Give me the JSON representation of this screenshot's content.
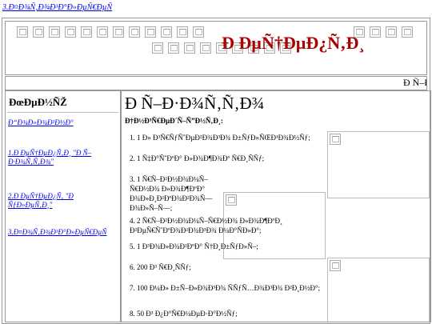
{
  "top_link": "3.Ð¤Ð¾Ñ‚Ð¾Ð³Ð°Ð»ÐµÑ€ÐµÑ",
  "site_title": "Ð ÐµÑ†ÐµÐ¿Ñ‚Ð¸",
  "strip_text": "Ð Ñ–Ð",
  "sidebar": {
    "heading": "ÐœÐµÐ½ÑŽ",
    "items": [
      {
        "label": "Ð“Ð¾Ð»Ð¾Ð²Ð½Ð°"
      },
      {
        "label": "1.Ð ÐµÑ†ÐµÐ¿Ñ‚Ð¸ \"Ð Ñ–Ð·Ð¾Ñ‚Ñ‚Ð¾\""
      },
      {
        "label": "2.Ð ÐµÑ†ÐµÐ¿Ñ‚ \"Ð ÑƒÐ»ÐµÑ‚Ð¸\""
      },
      {
        "label": "3.Ð¤Ð¾Ñ‚Ð¾Ð³Ð°Ð»ÐµÑ€ÐµÑ"
      }
    ]
  },
  "main": {
    "title": "Ð Ñ–Ð·Ð¾Ñ‚Ñ‚Ð¾",
    "subtitle": "Ð†Ð½Ð³Ñ€ÐµÐ´Ñ–Ñ”Ð½Ñ‚Ð¸:",
    "ingredients": [
      "1. 1 Ð» Ð³Ñ€ÑƒÑˆÐµÐ²Ð¾Ð³Ð¾ Ð±ÑƒÐ»ÑŒÐ¹Ð¾Ð½Ñƒ;",
      "2. 1 Ñ‡Ð°ÑˆÐºÐ° Ð»Ð¾Ð¶Ð¾Ðº Ñ€Ð¸ÑÑƒ;",
      "3. 1     Ñ€Ñ–Ð²Ð½Ð¾Ð¼Ñ–Ñ€Ð½Ð¾ Ð»Ð¾Ð¶ÐºÐ° Ð¾Ð»Ð¸Ð²ÐºÐ¾Ð²Ð¾Ñ— Ð¾Ð»Ñ–Ñ—;",
      "4. 2     Ñ€Ñ–Ð²Ð½Ð¾Ð¼Ñ–Ñ€Ð½Ð¾ Ð»Ð¾Ð¶ÐºÐ¸ Ð²ÐµÑ€ÑˆÐºÐ¾Ð²Ð¾Ð³Ð¾ Ð¼Ð°ÑÐ»Ð°;",
      "5. 1 Ð³Ð¾Ð»Ð¾Ð²ÐºÐ° Ñ†Ð¸Ð±ÑƒÐ»Ñ–;",
      "6. 200 Ð³ Ñ€Ð¸ÑÑƒ;",
      "7. 100    Ð¼Ð»    Ð±Ñ–Ð»Ð¾Ð³Ð¾    ÑÑƒÑ…Ð¾Ð³Ð¾ Ð²Ð¸Ð½Ð°;",
      "8. 50 Ð³ Ð¿Ð°Ñ€Ð¼ÐµÐ·Ð°Ð½Ñƒ;"
    ]
  }
}
